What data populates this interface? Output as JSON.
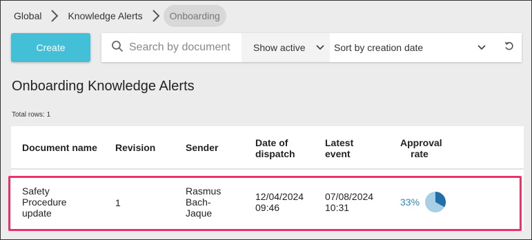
{
  "breadcrumb": {
    "items": [
      "Global",
      "Knowledge Alerts",
      "Onboarding"
    ]
  },
  "toolbar": {
    "create_label": "Create",
    "search_placeholder": "Search by document",
    "filter_label": "Show active",
    "sort_label": "Sort by creation date"
  },
  "page": {
    "title": "Onboarding Knowledge Alerts",
    "total_rows": "Total rows: 1"
  },
  "table": {
    "headers": {
      "document": "Document name",
      "revision": "Revision",
      "sender": "Sender",
      "dispatch_1": "Date of",
      "dispatch_2": "dispatch",
      "event_1": "Latest",
      "event_2": "event",
      "approval_1": "Approval",
      "approval_2": "rate"
    },
    "rows": [
      {
        "document_lines": [
          "Safety",
          "Procedure",
          "update"
        ],
        "revision": "1",
        "sender_lines": [
          "Rasmus",
          "Bach-",
          "Jaque"
        ],
        "dispatch_lines": [
          "12/04/2024",
          "09:46"
        ],
        "event_lines": [
          "07/08/2024",
          "10:31"
        ],
        "approval_rate": "33%",
        "approval_fraction": 0.33
      }
    ]
  },
  "colors": {
    "accent": "#44bfd8",
    "highlight": "#e8336b",
    "rate_text": "#2f86b8",
    "pie_fill": "#1f6fa8",
    "pie_bg": "#a9cfe6"
  },
  "icons": [
    "chevron-right-icon",
    "search-icon",
    "chevron-down-icon",
    "reset-icon"
  ]
}
